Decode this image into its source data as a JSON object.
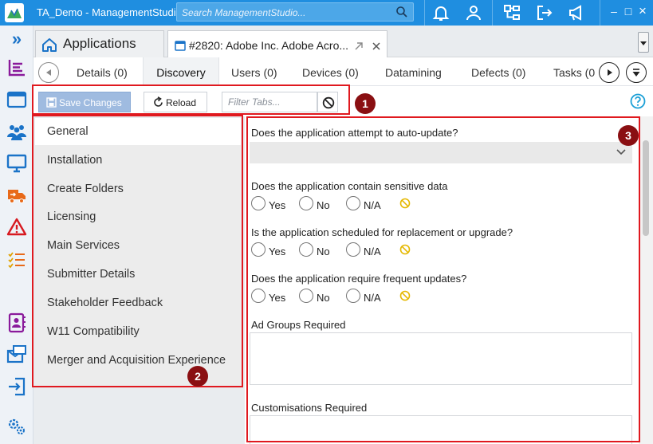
{
  "titlebar": {
    "app_title": "TA_Demo - ManagementStudi",
    "search_placeholder": "Search ManagementStudio...",
    "minimize": "–",
    "maximize": "□",
    "close": "×"
  },
  "doc_tabs": {
    "expand_glyph": "»",
    "home_tab": "Applications",
    "record_tab": "#2820: Adobe Inc. Adobe Acro..."
  },
  "sub_tabs": [
    {
      "label": "Details (0)"
    },
    {
      "label": "Discovery"
    },
    {
      "label": "Users (0)"
    },
    {
      "label": "Devices (0)"
    },
    {
      "label": "Datamining"
    },
    {
      "label": "Defects (0)"
    },
    {
      "label": "Tasks (0"
    }
  ],
  "toolbar": {
    "save_label": "Save Changes",
    "reload_label": "Reload",
    "filter_placeholder": "Filter Tabs..."
  },
  "nav": [
    {
      "label": "General"
    },
    {
      "label": "Installation"
    },
    {
      "label": "Create Folders"
    },
    {
      "label": "Licensing"
    },
    {
      "label": "Main Services"
    },
    {
      "label": "Submitter Details"
    },
    {
      "label": "Stakeholder Feedback"
    },
    {
      "label": "W11 Compatibility"
    },
    {
      "label": "Merger and Acquisition Experience"
    }
  ],
  "form": {
    "q1": "Does the application attempt to auto-update?",
    "q2": "Does the application contain sensitive data",
    "q3": "Is the application scheduled for replacement or upgrade?",
    "q4": "Does the application require frequent updates?",
    "opt_yes": "Yes",
    "opt_no": "No",
    "opt_na": "N/A",
    "ad_groups": "Ad Groups Required",
    "customisations": "Customisations Required"
  },
  "callouts": [
    "1",
    "2",
    "3"
  ],
  "colors": {
    "titlebar": "#1f8ee0",
    "accent_blue": "#1a73c8",
    "callout_red": "#e0191f",
    "badge_red": "#8a0f12",
    "save_button": "#9fbbe0"
  },
  "icons": {
    "rail": [
      "expand-icon",
      "dashboard-icon",
      "applications-icon",
      "users-icon",
      "devices-icon",
      "migration-icon",
      "defects-icon",
      "tasks-icon",
      "contacts-icon",
      "mailbox-icon",
      "import-icon",
      "settings-icon"
    ]
  }
}
